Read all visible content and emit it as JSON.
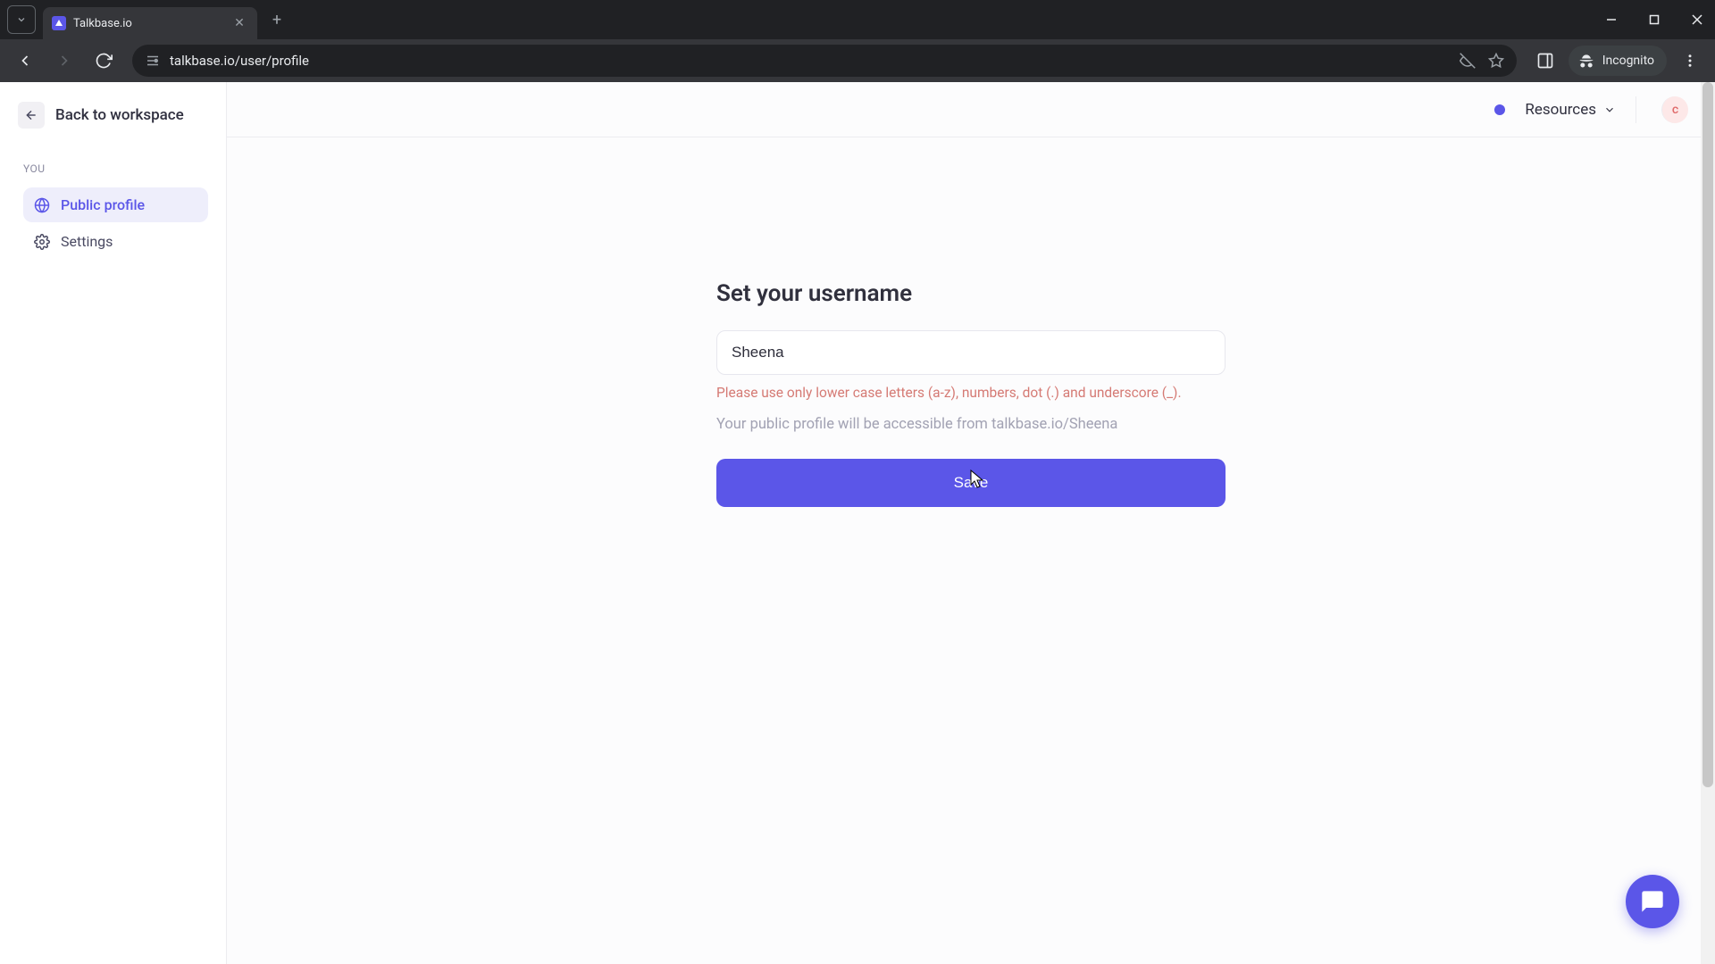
{
  "browser": {
    "tab_title": "Talkbase.io",
    "url": "talkbase.io/user/profile",
    "incognito_label": "Incognito"
  },
  "sidebar": {
    "back_label": "Back to workspace",
    "section_label": "YOU",
    "items": [
      {
        "label": "Public profile"
      },
      {
        "label": "Settings"
      }
    ]
  },
  "topbar": {
    "resources_label": "Resources",
    "avatar_initial": "c"
  },
  "form": {
    "title": "Set your username",
    "username_value": "Sheena",
    "error": "Please use only lower case letters (a-z), numbers, dot (.) and underscore (_).",
    "help": "Your public profile will be accessible from talkbase.io/Sheena",
    "save_label": "Save"
  }
}
